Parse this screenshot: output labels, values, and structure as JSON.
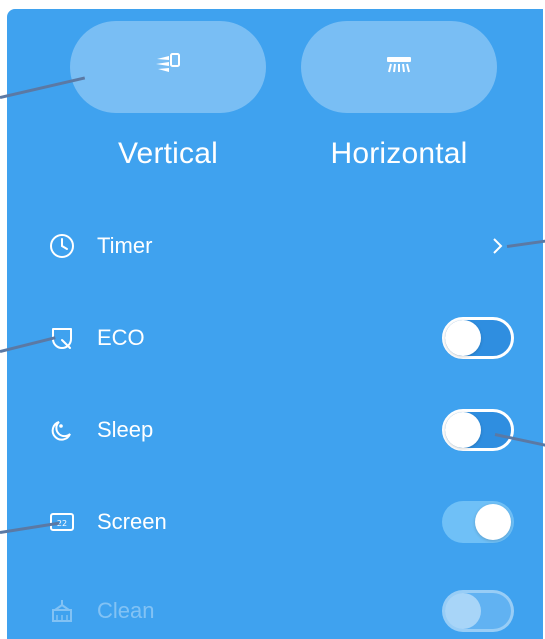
{
  "swing": {
    "vertical_label": "Vertical",
    "horizontal_label": "Horizontal"
  },
  "settings": {
    "items": [
      {
        "label": "Timer",
        "icon": "clock-icon",
        "control": "chevron"
      },
      {
        "label": "ECO",
        "icon": "leaf-icon",
        "control": "toggle",
        "state": "off"
      },
      {
        "label": "Sleep",
        "icon": "moon-icon",
        "control": "toggle",
        "state": "off"
      },
      {
        "label": "Screen",
        "icon": "screen-icon",
        "control": "toggle",
        "state": "on"
      },
      {
        "label": "Clean",
        "icon": "clean-icon",
        "control": "toggle",
        "state": "off",
        "disabled": true
      }
    ]
  },
  "colors": {
    "panel_bg": "#3fa2ef",
    "toggle_off_track": "#2f8ee0",
    "toggle_on_track": "#6fc0f7",
    "leader_line": "#5b79a4"
  }
}
